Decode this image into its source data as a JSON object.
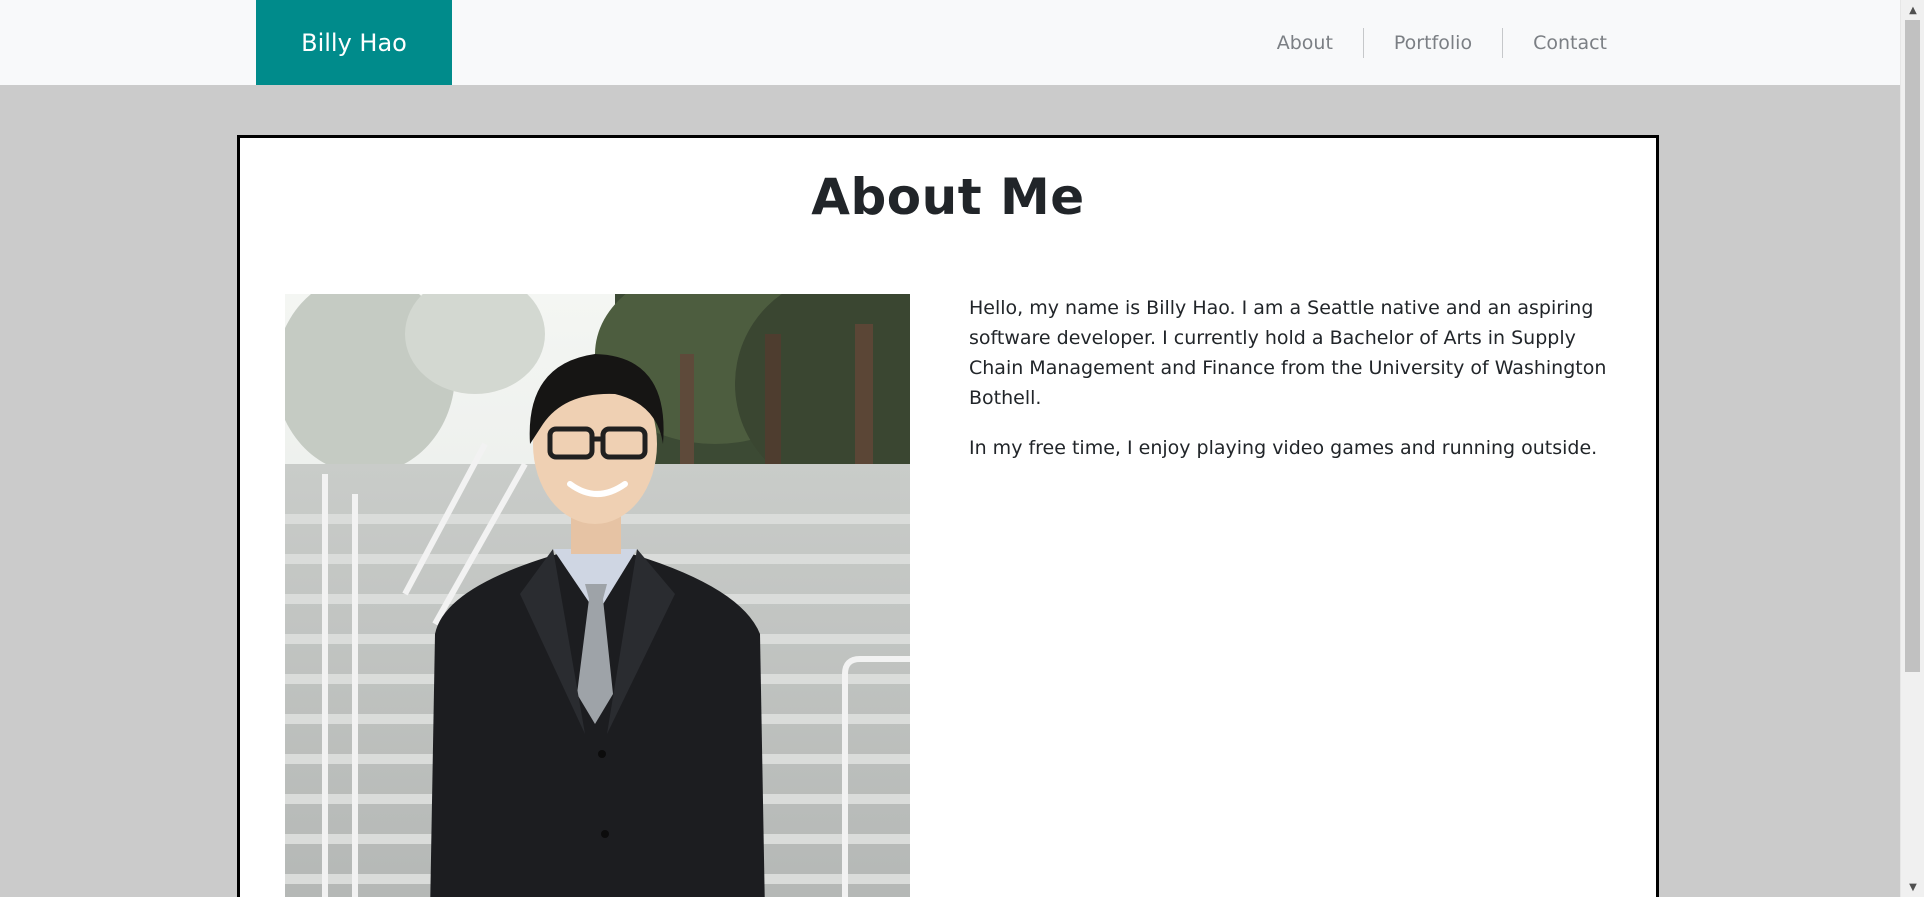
{
  "navbar": {
    "brand": "Billy Hao",
    "links": [
      "About",
      "Portfolio",
      "Contact"
    ]
  },
  "about": {
    "title": "About Me",
    "photo_alt": "Portrait of Billy Hao in a suit",
    "paragraphs": [
      "Hello, my name is Billy Hao. I am a Seattle native and an aspiring software developer. I currently hold a Bachelor of Arts in Supply Chain Management and Finance from the University of Washington Bothell.",
      "In my free time, I enjoy playing video games and running outside."
    ]
  },
  "colors": {
    "brand_bg": "#008b8b",
    "page_bg": "#cbcbcb",
    "navbar_bg": "#f8f9fa",
    "card_border": "#000000"
  },
  "icons": {
    "scroll_up": "triangle-up",
    "scroll_down": "triangle-down"
  }
}
